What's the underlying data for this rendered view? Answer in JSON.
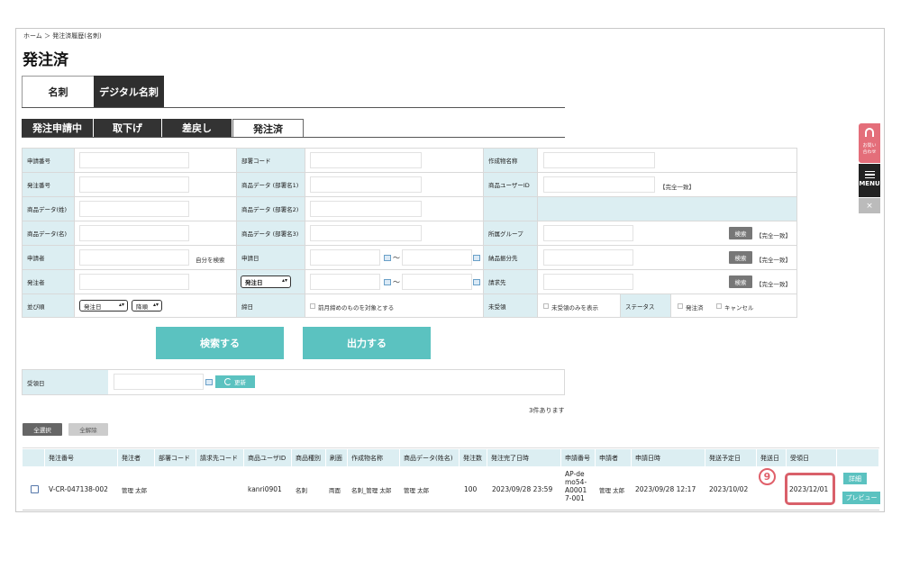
{
  "breadcrumb": "ホーム ＞ 発注済履歴(名刺)",
  "page_title": "発注済",
  "top_tabs": [
    "名刺",
    "デジタル名刺"
  ],
  "sub_tabs": [
    "発注申請中",
    "取下げ",
    "差戻し",
    "発注済"
  ],
  "form": {
    "application_no": "申請番号",
    "order_no": "発注番号",
    "product_data_last": "商品データ(姓)",
    "product_data_first": "商品データ(名)",
    "applicant": "申請者",
    "orderer": "発注者",
    "sort_order": "並び順",
    "dept_code": "部署コード",
    "product_dept1": "商品データ (部署名1)",
    "product_dept2": "商品データ (部署名2)",
    "product_dept3": "商品データ (部署名3)",
    "application_date": "申請日",
    "date_type_select": "発注日",
    "deadline": "締日",
    "prev_deadline_check": "前月締めのものを対象とする",
    "work_name": "作成物名称",
    "product_user_id": "商品ユーザーID",
    "exact_match": "【完全一致】",
    "group": "所属グループ",
    "delivery_dest": "納品振分先",
    "billing_dest": "請求先",
    "unreceived": "未受領",
    "unreceived_only": "未受領のみを表示",
    "status": "ステータス",
    "status_ordered": "発注済",
    "status_cancel": "キャンセル",
    "search_btn": "検索",
    "self_search": "自分を検索",
    "tilde": "〜",
    "sort_select": "発注日",
    "sort_dir_select": "降順"
  },
  "actions": {
    "search": "検索する",
    "export": "出力する"
  },
  "receipt": {
    "label": "受領日",
    "update": "更新"
  },
  "result_count": "3件あります",
  "select_all": "全選択",
  "deselect_all": "全解除",
  "columns": [
    "発注番号",
    "発注者",
    "部署コード",
    "請求先コード",
    "商品ユーザID",
    "商品種別",
    "刷面",
    "作成物名称",
    "商品データ(姓名)",
    "発注数",
    "発注完了日時",
    "申請番号",
    "申請者",
    "申請日時",
    "発送予定日",
    "発送日",
    "受領日"
  ],
  "row": {
    "order_no": "V-CR-047138-002",
    "orderer": "管理 太郎",
    "user_id": "kanri0901",
    "kind": "名刺",
    "side": "両面",
    "work_name": "名刺_管理 太郎",
    "product_name": "管理 太郎",
    "qty": "100",
    "completed": "2023/09/28 23:59",
    "app_no_1": "AP-de",
    "app_no_2": "mo54-",
    "app_no_3": "A0001",
    "app_no_4": "7-001",
    "applicant": "管理 太郎",
    "app_datetime": "2023/09/28 12:17",
    "ship_plan": "2023/10/02",
    "received": "2023/12/01",
    "detail_btn": "詳細",
    "preview_btn": "プレビュー"
  },
  "annotation_number": "9",
  "side_widgets": {
    "help_line1": "お問い",
    "help_line2": "合わせ",
    "menu": "MENU",
    "close": "×"
  },
  "colors": {
    "accent": "#5bc2c0",
    "label_bg": "#dceef2",
    "highlight": "#d9606a"
  }
}
